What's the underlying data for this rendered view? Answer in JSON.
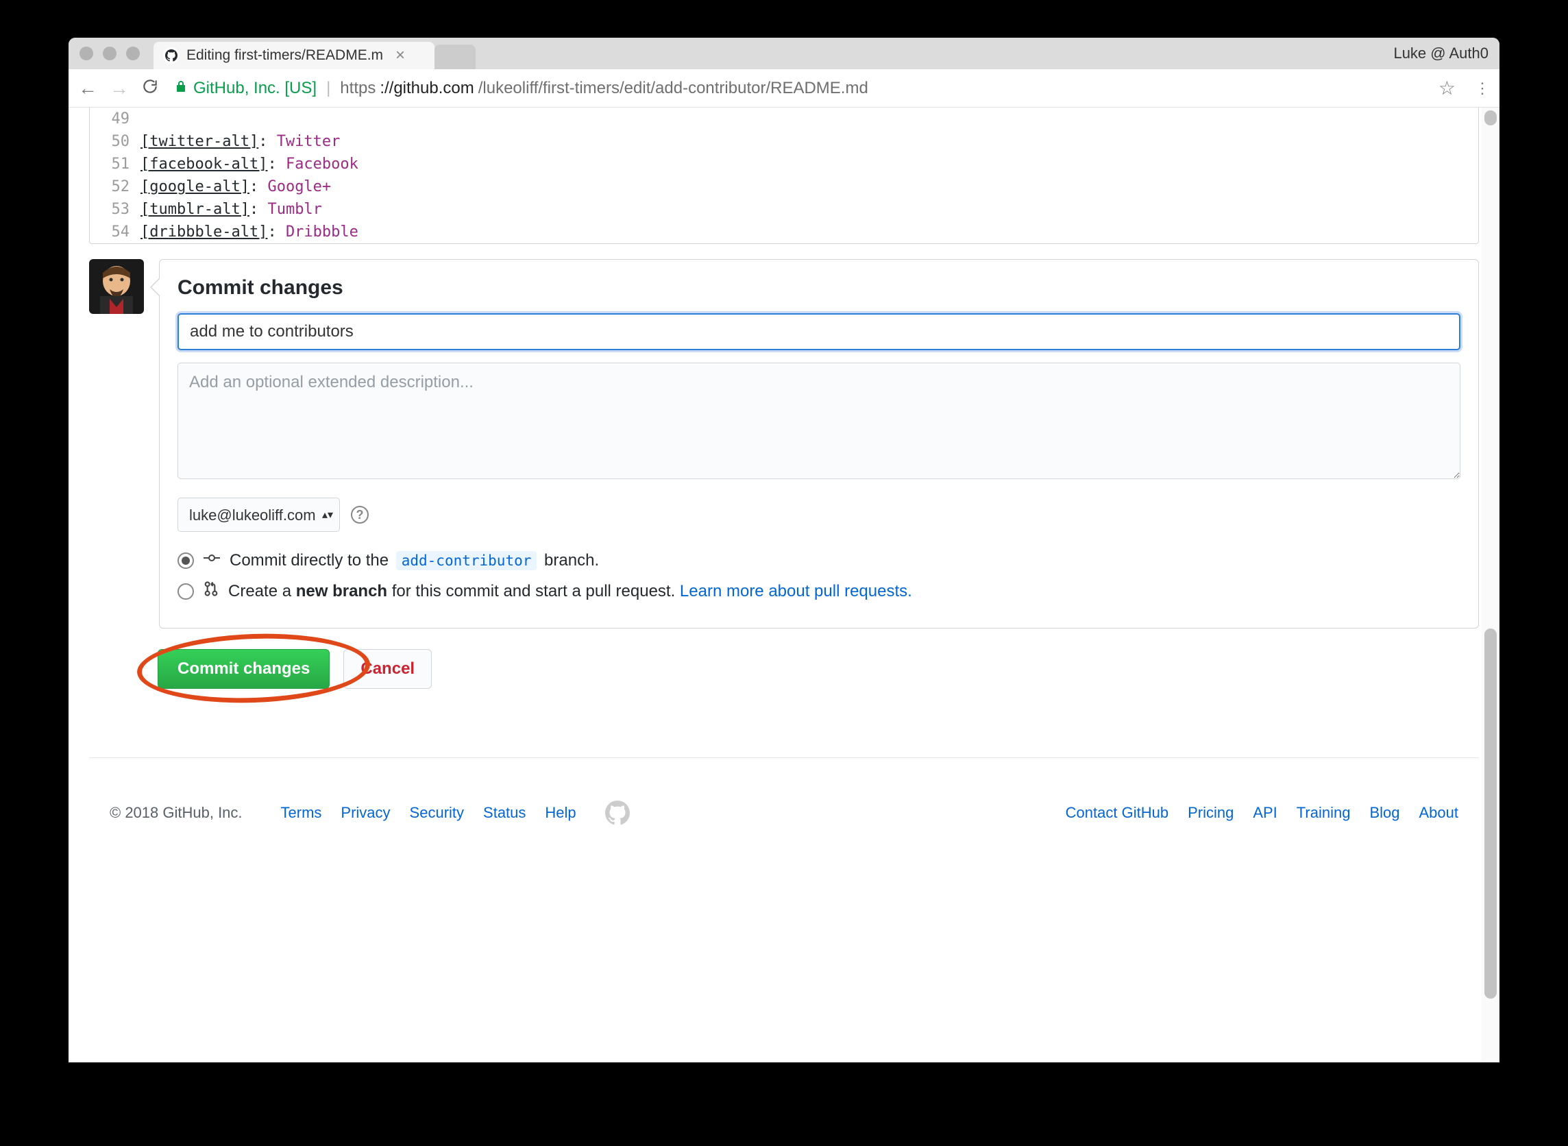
{
  "browser": {
    "profile_label": "Luke @ Auth0",
    "tab_title": "Editing first-timers/README.m",
    "ev_label": "GitHub, Inc. [US]",
    "url_scheme": "https",
    "url_host": "://github.com",
    "url_path": "/lukeoliff/first-timers/edit/add-contributor/README.md"
  },
  "editor": {
    "lines": [
      {
        "n": "49",
        "key": "",
        "val": ""
      },
      {
        "n": "50",
        "key": "[twitter-alt]",
        "val": "Twitter"
      },
      {
        "n": "51",
        "key": "[facebook-alt]",
        "val": "Facebook"
      },
      {
        "n": "52",
        "key": "[google-alt]",
        "val": "Google+"
      },
      {
        "n": "53",
        "key": "[tumblr-alt]",
        "val": "Tumblr"
      },
      {
        "n": "54",
        "key": "[dribbble-alt]",
        "val": "Dribbble"
      }
    ]
  },
  "commit": {
    "heading": "Commit changes",
    "message_value": "add me to contributors",
    "description_placeholder": "Add an optional extended description...",
    "email_selected": "luke@lukeoliff.com",
    "radio_direct_pre": "Commit directly to the ",
    "radio_direct_branch": "add-contributor",
    "radio_direct_post": " branch.",
    "radio_newbranch_pre": "Create a ",
    "radio_newbranch_strong": "new branch",
    "radio_newbranch_mid": " for this commit and start a pull request. ",
    "radio_newbranch_link": "Learn more about pull requests.",
    "commit_button": "Commit changes",
    "cancel_button": "Cancel"
  },
  "footer": {
    "copyright": "© 2018 GitHub, Inc.",
    "left_links": [
      "Terms",
      "Privacy",
      "Security",
      "Status",
      "Help"
    ],
    "right_links": [
      "Contact GitHub",
      "Pricing",
      "API",
      "Training",
      "Blog",
      "About"
    ]
  }
}
